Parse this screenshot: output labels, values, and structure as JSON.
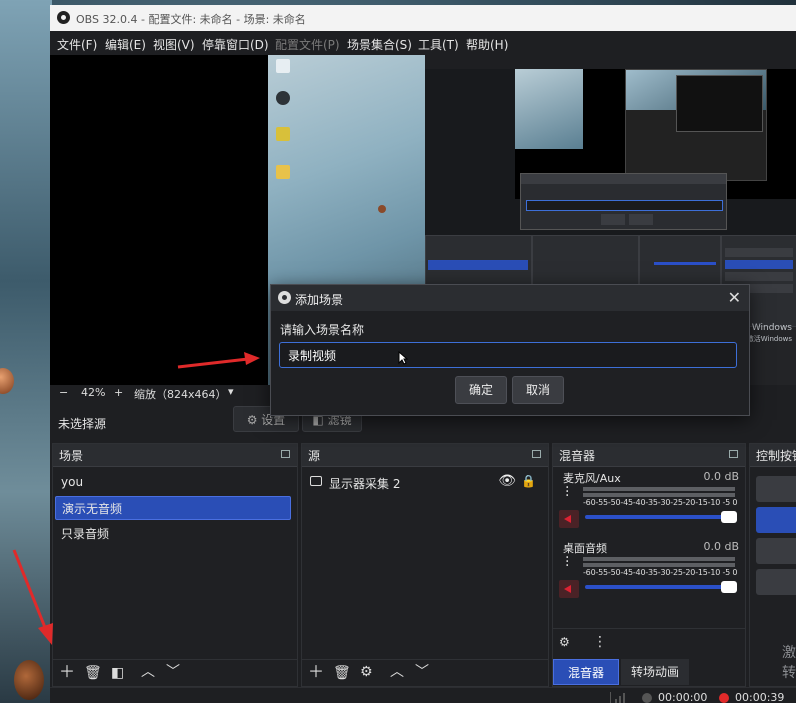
{
  "window": {
    "title": "OBS 32.0.4 - 配置文件: 未命名 - 场景: 未命名"
  },
  "menu": [
    {
      "label": "文件(F)",
      "disabled": false
    },
    {
      "label": "编辑(E)",
      "disabled": false
    },
    {
      "label": "视图(V)",
      "disabled": false
    },
    {
      "label": "停靠窗口(D)",
      "disabled": false
    },
    {
      "label": "配置文件(P)",
      "disabled": true
    },
    {
      "label": "场景集合(S)",
      "disabled": false
    },
    {
      "label": "工具(T)",
      "disabled": false
    },
    {
      "label": "帮助(H)",
      "disabled": false
    }
  ],
  "preview_toolbar": {
    "zoom_out": "−",
    "zoom_level": "42%",
    "zoom_in": "+",
    "scale_label": "缩放（824x464）",
    "dropdown": "▾"
  },
  "source_toolbar": {
    "no_source": "未选择源",
    "settings": "设置",
    "filters": "滤镜"
  },
  "docks": {
    "scenes": {
      "title": "场景",
      "items": [
        "you",
        "演示无音频",
        "只录音频"
      ],
      "selected_index": 1
    },
    "sources": {
      "title": "源",
      "items": [
        {
          "label": "显示器采集 2",
          "visible": true,
          "locked": false
        }
      ]
    },
    "mixer": {
      "title": "混音器",
      "tracks": [
        {
          "name": "麦克风/Aux",
          "db": "0.0 dB",
          "muted": true
        },
        {
          "name": "桌面音频",
          "db": "0.0 dB",
          "muted": true
        }
      ],
      "scale": "-60-55-50-45-40-35-30-25-20-15-10 -5  0",
      "tabs": [
        {
          "label": "混音器",
          "active": true
        },
        {
          "label": "转场动画",
          "active": false
        }
      ]
    },
    "controls": {
      "title": "控制按钮",
      "side_text": [
        "激",
        "转"
      ]
    }
  },
  "statusbar": {
    "stream_time": "00:00:00",
    "rec_time": "00:00:39"
  },
  "dialog": {
    "title": "添加场景",
    "close": "✕",
    "prompt": "请输入场景名称",
    "input_value": "录制视频",
    "ok": "确定",
    "cancel": "取消"
  },
  "nested_preview": {
    "win_activate_1": "活 Windows",
    "win_activate_2": "到\"设置\"以激活Windows"
  },
  "colors": {
    "accent": "#2a4eb6",
    "arrow": "#e02a2a",
    "dock_bg": "#1f2023",
    "header_bg": "#2b2d31"
  }
}
